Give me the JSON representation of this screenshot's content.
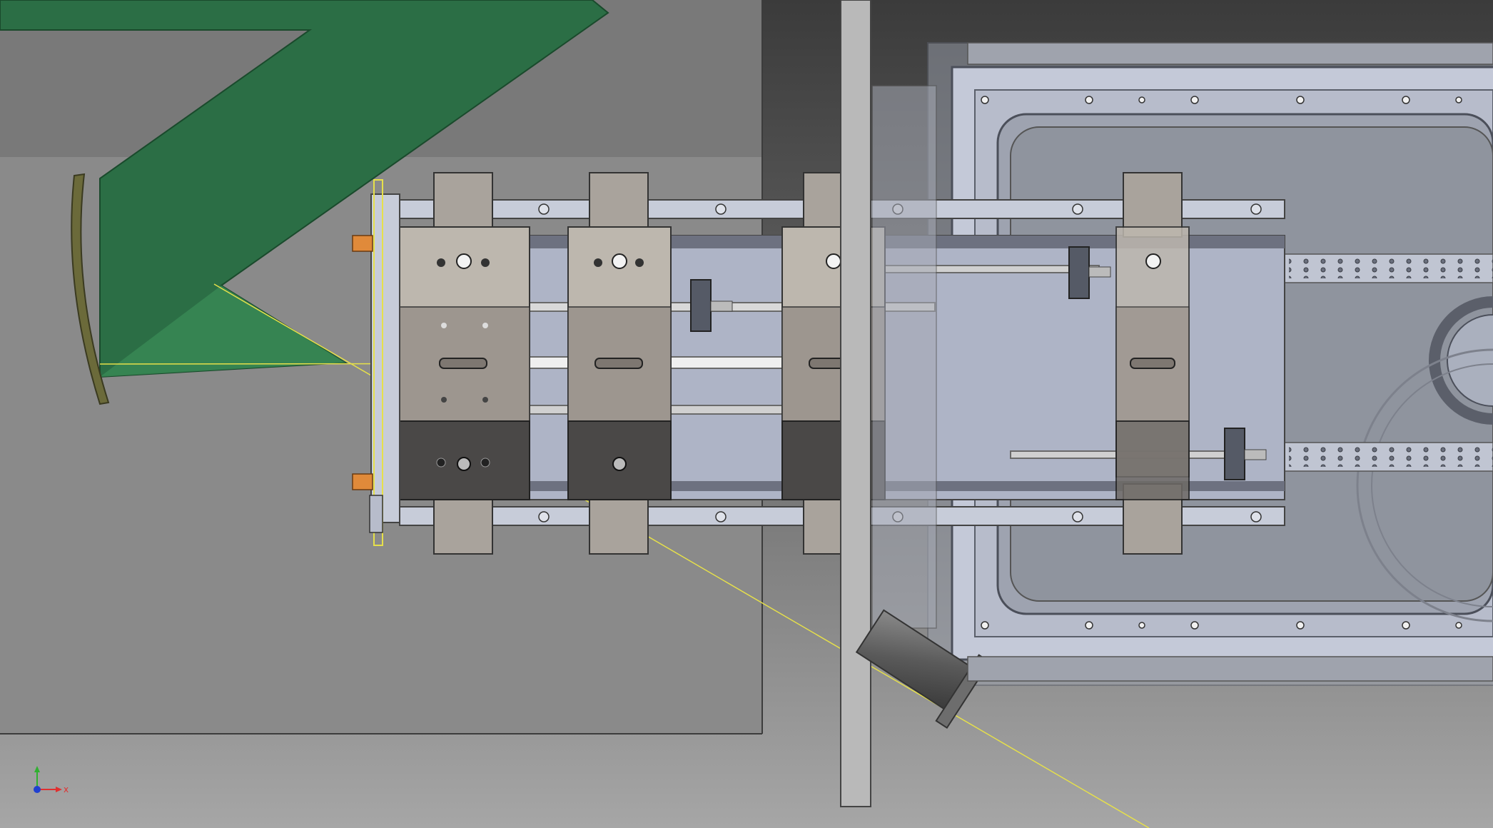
{
  "viewport": {
    "background_top": "#3a3a3a",
    "background_bottom": "#a0a0a0"
  },
  "triad": {
    "x_label": "x",
    "x_color": "#e03030",
    "y_color": "#30b030",
    "z_color": "#2040d0"
  },
  "colors": {
    "green_part": "#2b6e45",
    "frame_metal": "#c4c9d8",
    "block_light": "#bdb7ae",
    "block_mid": "#9d968f",
    "block_dark": "#4a4847",
    "orange_part": "#e08a3a",
    "yellow_guide": "#e6e04a"
  }
}
